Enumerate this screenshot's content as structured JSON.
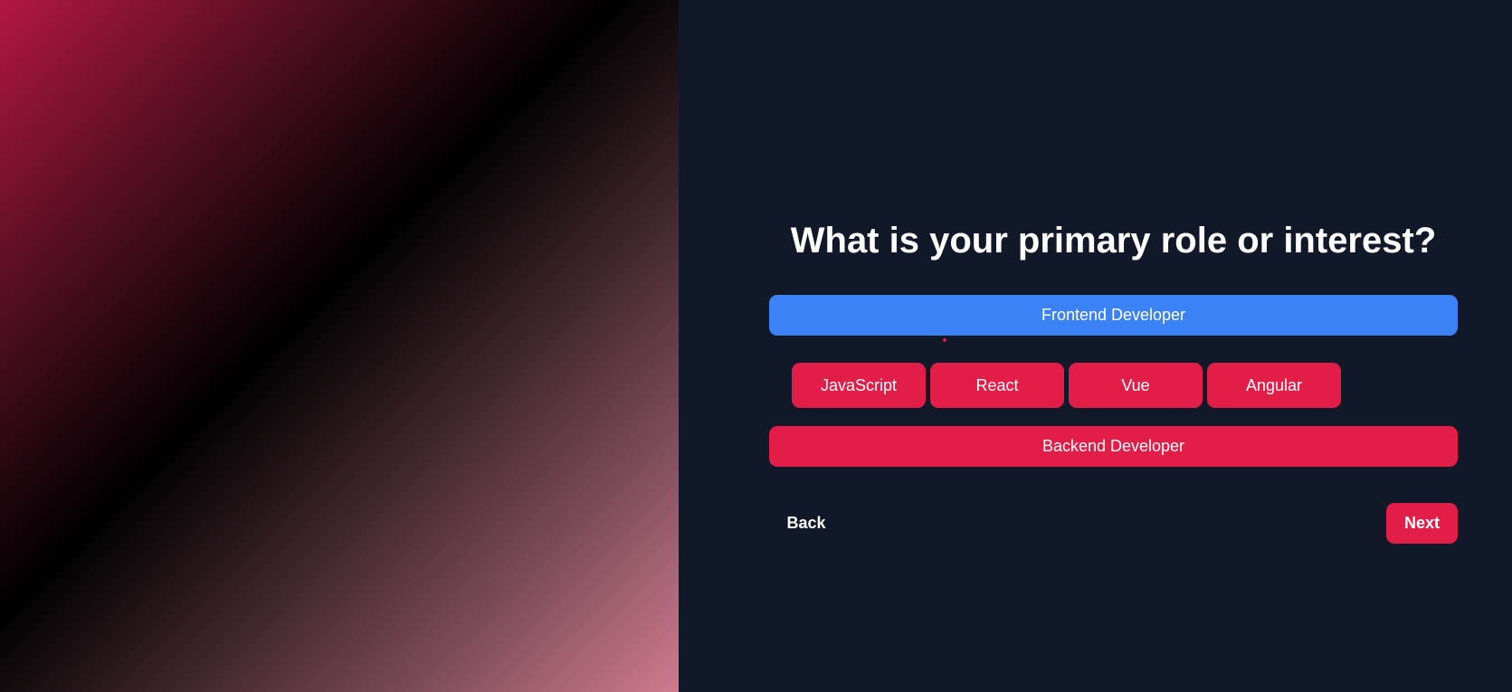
{
  "question": {
    "title": "What is your primary role or interest?"
  },
  "options": [
    {
      "label": "Frontend Developer",
      "selected": true,
      "color": "#3b82f6"
    },
    {
      "label": "Backend Developer",
      "selected": false,
      "color": "#e11d48"
    }
  ],
  "sub_options": [
    {
      "label": "JavaScript"
    },
    {
      "label": "React"
    },
    {
      "label": "Vue"
    },
    {
      "label": "Angular"
    }
  ],
  "navigation": {
    "back_label": "Back",
    "next_label": "Next"
  },
  "colors": {
    "background": "#111827",
    "accent": "#e11d48",
    "selected": "#3b82f6",
    "text": "#ffffff"
  }
}
